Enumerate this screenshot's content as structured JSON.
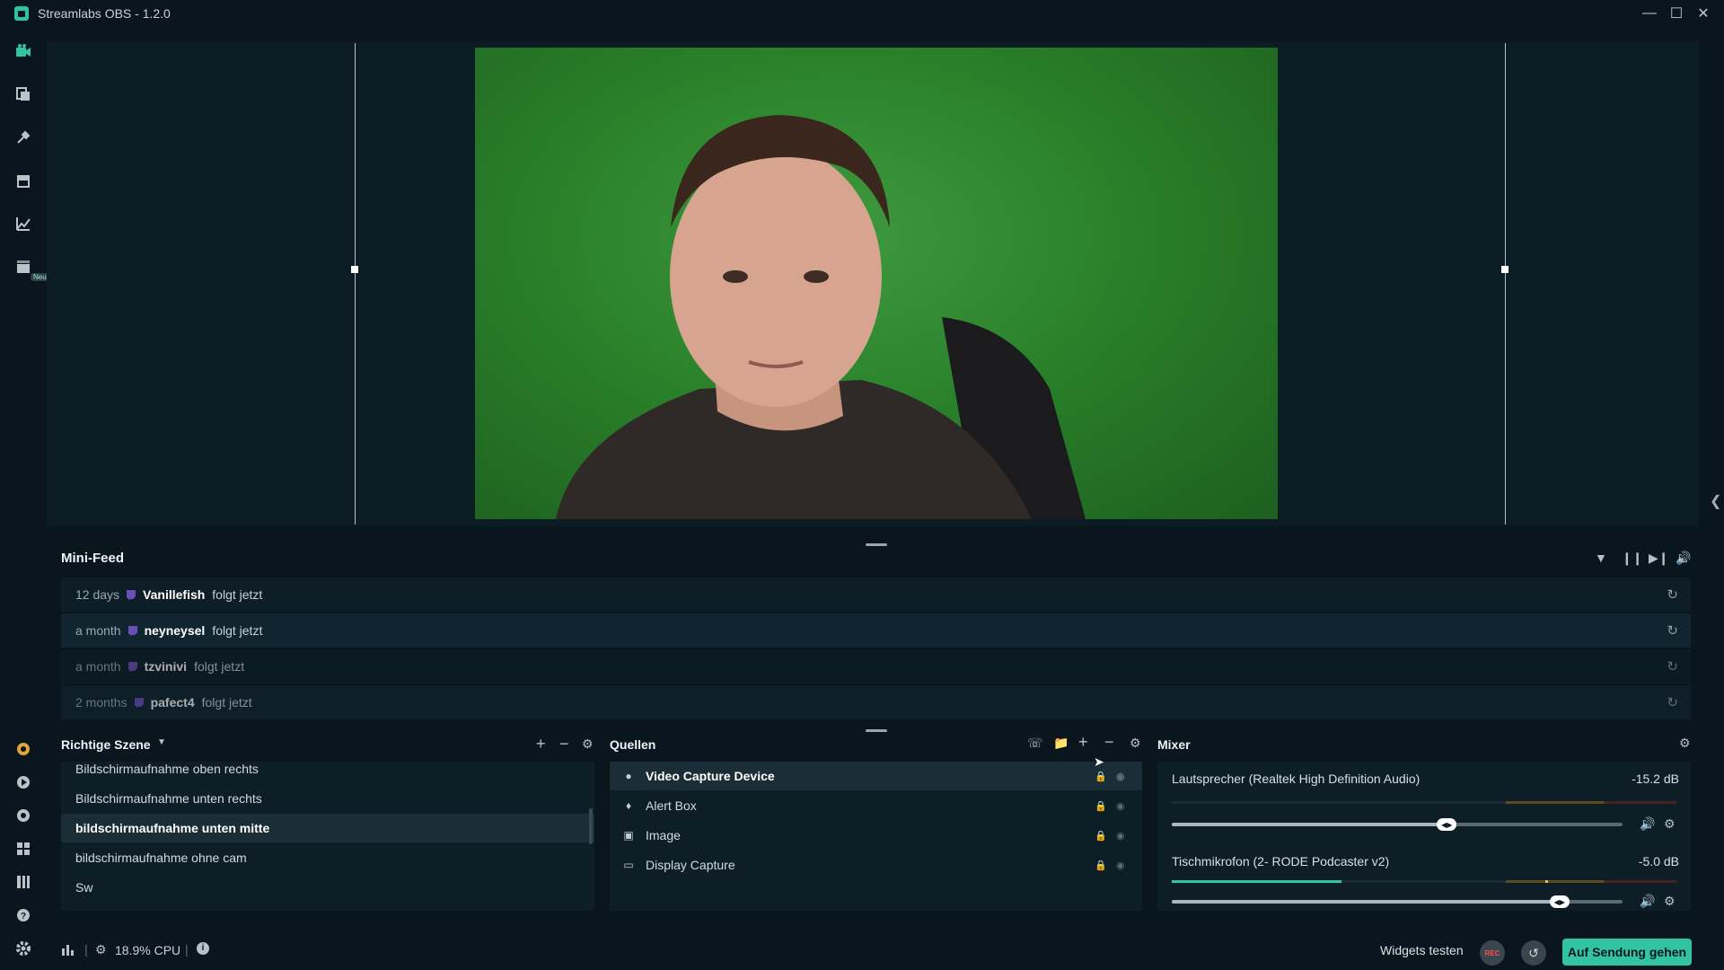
{
  "window": {
    "title": "Streamlabs OBS - 1.2.0",
    "controls": [
      "minimize-icon",
      "maximize-icon",
      "close-icon"
    ]
  },
  "nav": {
    "items": [
      "editor-icon",
      "themes-icon",
      "widgets-icon",
      "store-icon",
      "dashboard-icon",
      "highlighter-icon"
    ],
    "badge": "Neu",
    "bottom_items": [
      "prime-icon",
      "cloud-icon",
      "help-chat-icon",
      "layout-icon",
      "studio-mode-icon",
      "help-icon",
      "settings-icon"
    ]
  },
  "minifeed": {
    "title": "Mini-Feed",
    "rows": [
      {
        "time": "12 days",
        "user": "Vanillefish",
        "action": "folgt jetzt"
      },
      {
        "time": "a month",
        "user": "neyneysel",
        "action": "folgt jetzt"
      },
      {
        "time": "a month",
        "user": "tzvinivi",
        "action": "folgt jetzt"
      },
      {
        "time": "2 months",
        "user": "pafect4",
        "action": "folgt jetzt"
      }
    ]
  },
  "scenes": {
    "title": "Richtige Szene",
    "items": [
      "Bildschirmaufnahme oben rechts",
      "Bildschirmaufnahme unten rechts",
      "bildschirmaufnahme unten mitte",
      "bildschirmaufnahme ohne cam",
      "Sw"
    ],
    "active_index": 2
  },
  "sources": {
    "title": "Quellen",
    "items": [
      {
        "name": "Video Capture Device",
        "icon": "camera-icon"
      },
      {
        "name": "Alert Box",
        "icon": "bell-icon"
      },
      {
        "name": "Image",
        "icon": "image-icon"
      },
      {
        "name": "Display Capture",
        "icon": "monitor-icon"
      }
    ],
    "active_index": 0
  },
  "mixer": {
    "title": "Mixer",
    "channels": [
      {
        "name": "Lautsprecher (Realtek High Definition Audio)",
        "db": "-15.2 dB",
        "level": 0.61
      },
      {
        "name": "Tischmikrofon (2- RODE Podcaster v2)",
        "db": "-5.0 dB",
        "level": 0.86
      }
    ]
  },
  "footer": {
    "cpu": "18.9% CPU",
    "widgets_test": "Widgets testen",
    "rec": "REC",
    "go_live": "Auf Sendung gehen"
  },
  "colors": {
    "accent": "#31c3a2",
    "background": "#09161d",
    "panel": "#0d1e26",
    "rec": "#f85151"
  }
}
